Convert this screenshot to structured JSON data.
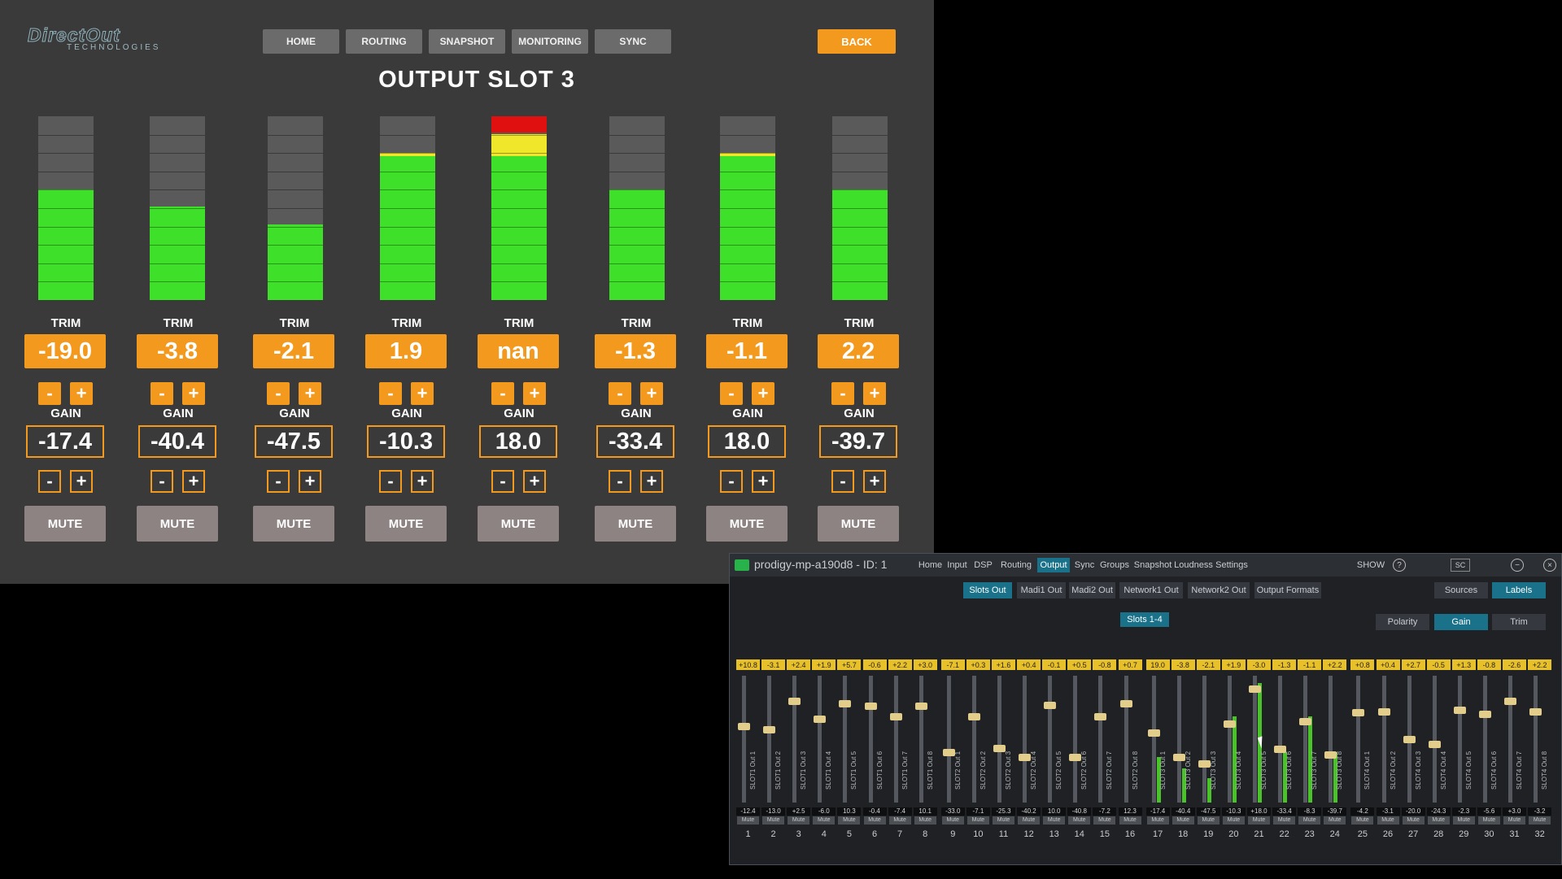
{
  "logo": {
    "line1": "DirectOut",
    "line2": "TECHNOLOGIES"
  },
  "nav": [
    {
      "label": "HOME"
    },
    {
      "label": "ROUTING"
    },
    {
      "label": "SNAPSHOT"
    },
    {
      "label": "MONITORING"
    },
    {
      "label": "SYNC"
    }
  ],
  "back_label": "BACK",
  "title": "OUTPUT SLOT 3",
  "labels": {
    "trim": "TRIM",
    "gain": "GAIN",
    "minus": "-",
    "plus": "+",
    "mute": "MUTE"
  },
  "channels": [
    {
      "trim": "-19.0",
      "gain": "-17.4",
      "meter_level": 0.6,
      "peak": false
    },
    {
      "trim": "-3.8",
      "gain": "-40.4",
      "meter_level": 0.51,
      "peak": false
    },
    {
      "trim": "-2.1",
      "gain": "-47.5",
      "meter_level": 0.41,
      "peak": false
    },
    {
      "trim": "1.9",
      "gain": "-10.3",
      "meter_level": 0.8,
      "peak": false
    },
    {
      "trim": "nan",
      "gain": "18.0",
      "meter_level": 1.0,
      "peak": true
    },
    {
      "trim": "-1.3",
      "gain": "-33.4",
      "meter_level": 0.6,
      "peak": false
    },
    {
      "trim": "-1.1",
      "gain": "18.0",
      "meter_level": 0.8,
      "peak": false
    },
    {
      "trim": "2.2",
      "gain": "-39.7",
      "meter_level": 0.6,
      "peak": false
    }
  ],
  "colors": {
    "accent": "#f39a1e",
    "meter_green": "#3fe02a",
    "meter_yellow": "#f0e62a",
    "meter_red": "#e01010",
    "panel_bg": "#3a3a3a"
  },
  "window": {
    "title": "prodigy-mp-a190d8 - ID: 1",
    "tabs": [
      "Home",
      "Input",
      "DSP",
      "Routing",
      "Output",
      "Sync",
      "Groups",
      "Snapshot",
      "Loudness",
      "Settings"
    ],
    "active_tab": "Output",
    "show_label": "SHOW",
    "help": "?",
    "sc": "SC",
    "subtabs": [
      "Slots Out",
      "Madi1 Out",
      "Madi2 Out",
      "Network1 Out",
      "Network2 Out",
      "Output Formats"
    ],
    "active_subtab": "Slots Out",
    "right_tabs": [
      "Sources",
      "Labels"
    ],
    "slots_label": "Slots 1-4",
    "mode_tabs": [
      "Polarity",
      "Gain",
      "Trim"
    ],
    "mute_label": "Mute",
    "strips": [
      {
        "top": "+10.8",
        "bottom": "-12.4",
        "name": "SLOT1 Out 1",
        "num": "1",
        "knob": 0.6,
        "meter": 0
      },
      {
        "top": "-3.1",
        "bottom": "-13.0",
        "name": "SLOT1 Out 2",
        "num": "2",
        "knob": 0.58,
        "meter": 0
      },
      {
        "top": "+2.4",
        "bottom": "+2.5",
        "name": "SLOT1 Out 3",
        "num": "3",
        "knob": 0.8,
        "meter": 0
      },
      {
        "top": "+1.9",
        "bottom": "-6.0",
        "name": "SLOT1 Out 4",
        "num": "4",
        "knob": 0.66,
        "meter": 0
      },
      {
        "top": "+5.7",
        "bottom": "10.3",
        "name": "SLOT1 Out 5",
        "num": "5",
        "knob": 0.78,
        "meter": 0
      },
      {
        "top": "-0.6",
        "bottom": "-0.4",
        "name": "SLOT1 Out 6",
        "num": "6",
        "knob": 0.76,
        "meter": 0
      },
      {
        "top": "+2.2",
        "bottom": "-7.4",
        "name": "SLOT1 Out 7",
        "num": "7",
        "knob": 0.68,
        "meter": 0
      },
      {
        "top": "+3.0",
        "bottom": "10.1",
        "name": "SLOT1 Out 8",
        "num": "8",
        "knob": 0.76,
        "meter": 0
      },
      {
        "top": "-7.1",
        "bottom": "-33.0",
        "name": "SLOT2 Out 1",
        "num": "9",
        "knob": 0.4,
        "meter": 0
      },
      {
        "top": "+0.3",
        "bottom": "-7.1",
        "name": "SLOT2 Out 2",
        "num": "10",
        "knob": 0.68,
        "meter": 0
      },
      {
        "top": "+1.6",
        "bottom": "-25.3",
        "name": "SLOT2 Out 3",
        "num": "11",
        "knob": 0.43,
        "meter": 0
      },
      {
        "top": "+0.4",
        "bottom": "-40.2",
        "name": "SLOT2 Out 4",
        "num": "12",
        "knob": 0.36,
        "meter": 0
      },
      {
        "top": "-0.1",
        "bottom": "10.0",
        "name": "SLOT2 Out 5",
        "num": "13",
        "knob": 0.77,
        "meter": 0
      },
      {
        "top": "+0.5",
        "bottom": "-40.8",
        "name": "SLOT2 Out 6",
        "num": "14",
        "knob": 0.36,
        "meter": 0
      },
      {
        "top": "-0.8",
        "bottom": "-7.2",
        "name": "SLOT2 Out 7",
        "num": "15",
        "knob": 0.68,
        "meter": 0
      },
      {
        "top": "+0.7",
        "bottom": "12.3",
        "name": "SLOT2 Out 8",
        "num": "16",
        "knob": 0.78,
        "meter": 0
      },
      {
        "top": "19.0",
        "bottom": "-17.4",
        "name": "SLOT3 Out 1",
        "num": "17",
        "knob": 0.55,
        "meter": 0.36
      },
      {
        "top": "-3.8",
        "bottom": "-40.4",
        "name": "SLOT3 Out 2",
        "num": "18",
        "knob": 0.36,
        "meter": 0.27
      },
      {
        "top": "-2.1",
        "bottom": "-47.5",
        "name": "SLOT3 Out 3",
        "num": "19",
        "knob": 0.31,
        "meter": 0.19
      },
      {
        "top": "+1.9",
        "bottom": "-10.3",
        "name": "SLOT3 Out 4",
        "num": "20",
        "knob": 0.62,
        "meter": 0.68
      },
      {
        "top": "-3.0",
        "bottom": "+18.0",
        "name": "SLOT3 Out 5",
        "num": "21",
        "knob": 0.9,
        "meter": 0.94
      },
      {
        "top": "-1.3",
        "bottom": "-33.4",
        "name": "SLOT3 Out 6",
        "num": "22",
        "knob": 0.42,
        "meter": 0.4
      },
      {
        "top": "-1.1",
        "bottom": "-8.3",
        "name": "SLOT3 Out 7",
        "num": "23",
        "knob": 0.64,
        "meter": 0.68
      },
      {
        "top": "+2.2",
        "bottom": "-39.7",
        "name": "SLOT3 Out 8",
        "num": "24",
        "knob": 0.38,
        "meter": 0.4
      },
      {
        "top": "+0.8",
        "bottom": "-4.2",
        "name": "SLOT4 Out 1",
        "num": "25",
        "knob": 0.71,
        "meter": 0
      },
      {
        "top": "+0.4",
        "bottom": "-3.1",
        "name": "SLOT4 Out 2",
        "num": "26",
        "knob": 0.72,
        "meter": 0
      },
      {
        "top": "+2.7",
        "bottom": "-20.0",
        "name": "SLOT4 Out 3",
        "num": "27",
        "knob": 0.5,
        "meter": 0
      },
      {
        "top": "-0.5",
        "bottom": "-24.3",
        "name": "SLOT4 Out 4",
        "num": "28",
        "knob": 0.46,
        "meter": 0
      },
      {
        "top": "+1.3",
        "bottom": "-2.3",
        "name": "SLOT4 Out 5",
        "num": "29",
        "knob": 0.73,
        "meter": 0
      },
      {
        "top": "-0.8",
        "bottom": "-5.6",
        "name": "SLOT4 Out 6",
        "num": "30",
        "knob": 0.7,
        "meter": 0
      },
      {
        "top": "-2.6",
        "bottom": "+3.0",
        "name": "SLOT4 Out 7",
        "num": "31",
        "knob": 0.8,
        "meter": 0
      },
      {
        "top": "+2.2",
        "bottom": "-3.2",
        "name": "SLOT4 Out 8",
        "num": "32",
        "knob": 0.72,
        "meter": 0
      }
    ]
  }
}
